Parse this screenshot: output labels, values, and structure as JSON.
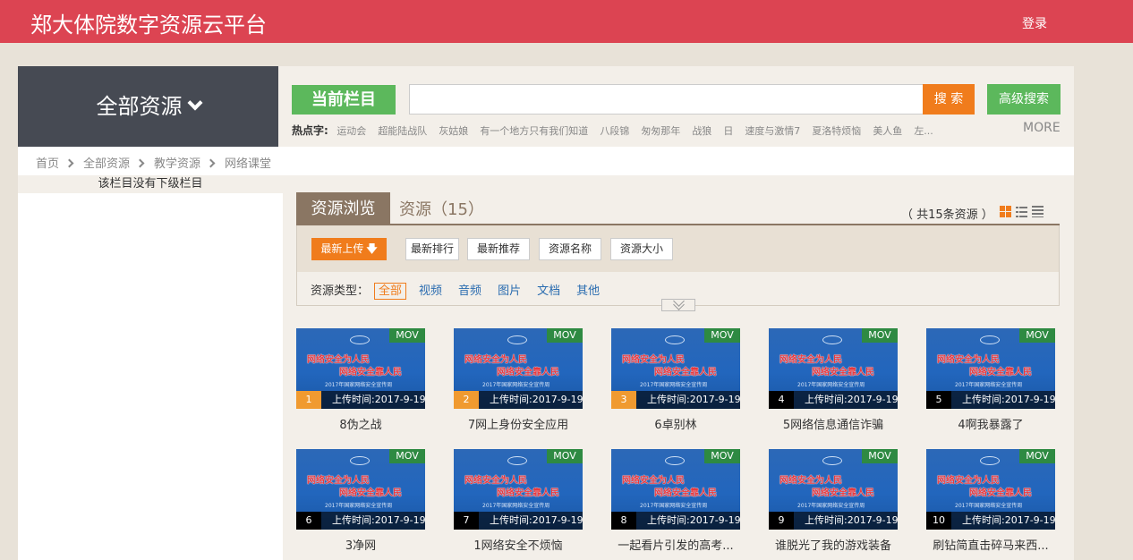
{
  "header": {
    "site_title": "郑大体院数字资源云平台",
    "login_label": "登录"
  },
  "nav": {
    "all_resources_label": "全部资源"
  },
  "search": {
    "current_column_label": "当前栏目",
    "query_value": "",
    "search_button": "搜 索",
    "advanced_button": "高级搜索",
    "hot_label": "热点字:",
    "hot_words": [
      "运动会",
      "超能陆战队",
      "灰姑娘",
      "有一个地方只有我们知道",
      "八段锦",
      "匆匆那年",
      "战狼",
      "日",
      "速度与激情7",
      "夏洛特烦恼",
      "美人鱼",
      "左..."
    ],
    "more_label": "MORE"
  },
  "breadcrumb": [
    "首页",
    "全部资源",
    "教学资源",
    "网络课堂"
  ],
  "sidebar": {
    "empty_note": "该栏目没有下级栏目"
  },
  "tabs": {
    "browse_label": "资源浏览",
    "resources_label": "资源（15）",
    "total_text": "（ 共15条资源 ）"
  },
  "sort": {
    "buttons": [
      "最新上传",
      "最新排行",
      "最新推荐",
      "资源名称",
      "资源大小"
    ],
    "active_index": 0,
    "active_arrow": "🡇"
  },
  "types": {
    "label": "资源类型：",
    "items": [
      "全部",
      "视频",
      "音频",
      "图片",
      "文档",
      "其他"
    ],
    "active_index": 0
  },
  "resources": [
    {
      "rank": "1",
      "title": "8伪之战",
      "format": "MOV",
      "upload_time": "上传时间:2017-9-19"
    },
    {
      "rank": "2",
      "title": "7网上身份安全应用",
      "format": "MOV",
      "upload_time": "上传时间:2017-9-19"
    },
    {
      "rank": "3",
      "title": "6卓别林",
      "format": "MOV",
      "upload_time": "上传时间:2017-9-19"
    },
    {
      "rank": "4",
      "title": "5网络信息通信诈骗",
      "format": "MOV",
      "upload_time": "上传时间:2017-9-19"
    },
    {
      "rank": "5",
      "title": "4啊我暴露了",
      "format": "MOV",
      "upload_time": "上传时间:2017-9-19"
    },
    {
      "rank": "6",
      "title": "3净网",
      "format": "MOV",
      "upload_time": "上传时间:2017-9-19"
    },
    {
      "rank": "7",
      "title": "1网络安全不烦恼",
      "format": "MOV",
      "upload_time": "上传时间:2017-9-19"
    },
    {
      "rank": "8",
      "title": "一起看片引发的高考...",
      "format": "MOV",
      "upload_time": "上传时间:2017-9-19"
    },
    {
      "rank": "9",
      "title": "谁脱光了我的游戏装备",
      "format": "MOV",
      "upload_time": "上传时间:2017-9-19"
    },
    {
      "rank": "10",
      "title": "刷钻简直击碎马来西...",
      "format": "MOV",
      "upload_time": "上传时间:2017-9-19"
    }
  ],
  "thumbnail_text": {
    "banner_line1": "网络安全为人民",
    "banner_line2": "网络安全靠人民",
    "sub_line": "2017年国家网络安全宣传周"
  },
  "colors": {
    "header_red": "#dc4452",
    "accent_orange": "#f07c1c",
    "accent_green": "#5cb85c",
    "tab_brown": "#8a7663",
    "link_blue": "#2a6cb0"
  }
}
